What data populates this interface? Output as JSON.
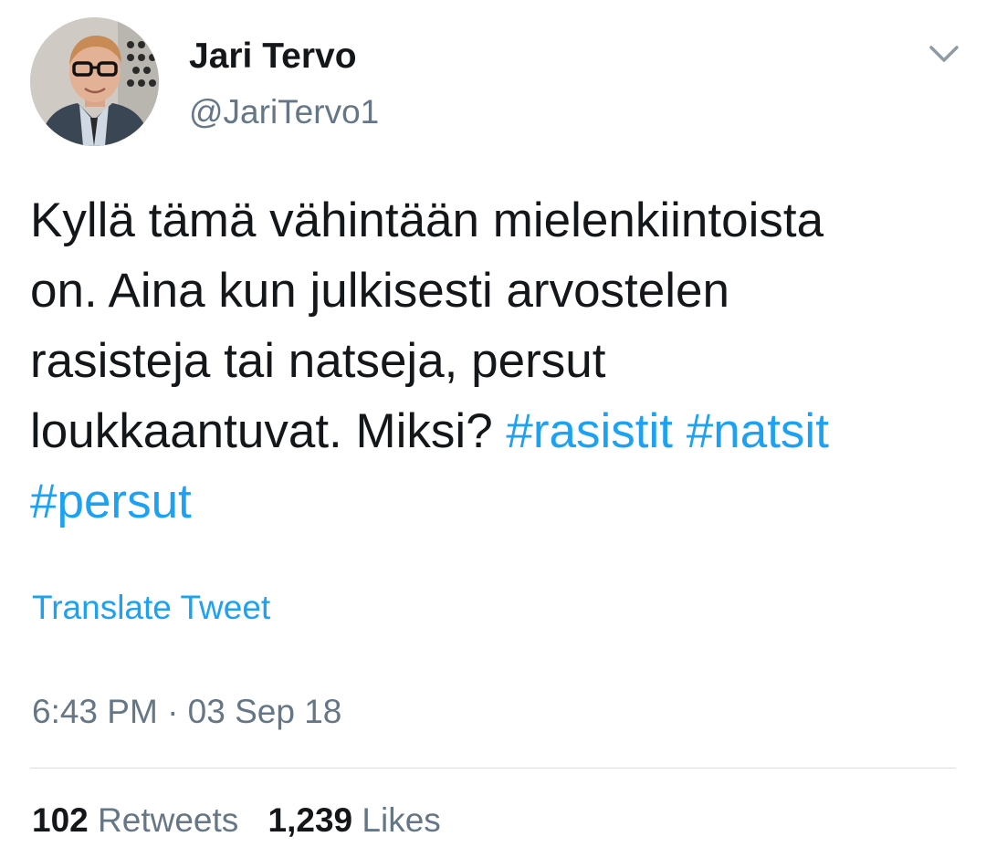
{
  "author": {
    "display_name": "Jari Tervo",
    "handle": "@JariTervo1"
  },
  "icons": {
    "avatar": "profile-photo",
    "menu": "chevron-down-icon"
  },
  "tweet": {
    "text_lines": [
      "Kyllä tämä vähintään mielenkiintoista",
      "on. Aina kun julkisesti arvostelen",
      "rasisteja tai natseja, persut",
      "loukkaantuvat. Miksi?"
    ],
    "hashtags": [
      "#rasistit",
      "#natsit",
      "#persut"
    ],
    "translate_label": "Translate Tweet",
    "timestamp": "6:43 PM · 03 Sep 18"
  },
  "stats": {
    "retweets_count": "102",
    "retweets_label": "Retweets",
    "likes_count": "1,239",
    "likes_label": "Likes"
  },
  "colors": {
    "link": "#1da1f2",
    "secondary_text": "#657786",
    "primary_text": "#14171a",
    "divider": "#d8dde2"
  }
}
